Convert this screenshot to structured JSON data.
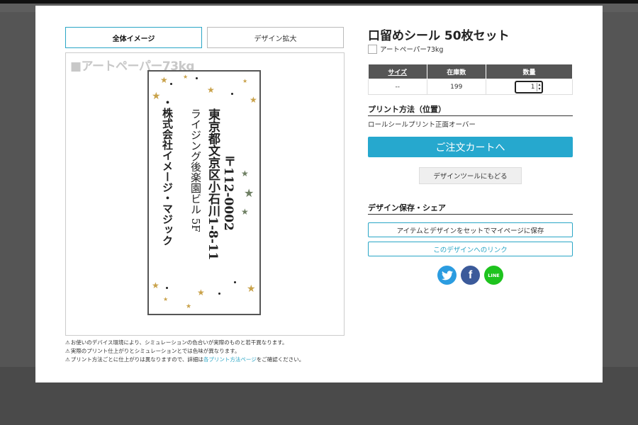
{
  "tabs": {
    "full": "全体イメージ",
    "zoom": "デザイン拡大"
  },
  "preview": {
    "paper_label": "■アートペーパー73kg",
    "postal": "〒112-0002",
    "address1": "東京都文京区小石川1-8-11",
    "address2": "ライジング後楽園ビル 5F",
    "company": "・株式会社イメージ・マジック"
  },
  "notes": {
    "warn_icon": "⚠",
    "line1": "お使いのデバイス環境により、シミュレーションの色合いが実際のものと若干異なります。",
    "line2": "実際のプリント仕上がりとシミュレーションとでは色味が異なります。",
    "line3_pre": "プリント方法ごとに仕上がりは異なりますので、詳細は",
    "line3_link": "各プリント方法ページ",
    "line3_post": "をご確認ください。"
  },
  "product": {
    "title": "口留めシール 50枚セット",
    "paper": "アートペーパー73kg"
  },
  "stock_table": {
    "headers": [
      "サイズ",
      "在庫数",
      "数量"
    ],
    "row": {
      "size": "--",
      "stock": "199",
      "qty": "1"
    }
  },
  "print_method": {
    "heading": "プリント方法（位置）",
    "value": "ロールシールプリント正面オーバー"
  },
  "buttons": {
    "cart": "ご注文カートへ",
    "back": "デザインツールにもどる",
    "save": "アイテムとデザインをセットでマイページに保存",
    "link": "このデザインへのリンク"
  },
  "share": {
    "heading": "デザイン保存・シェア",
    "line_label": "LINE"
  },
  "colors": {
    "accent": "#26a8ce",
    "table_header": "#555555",
    "twitter": "#2b9ce0",
    "facebook": "#3b5a9a",
    "line": "#1ec31e"
  }
}
